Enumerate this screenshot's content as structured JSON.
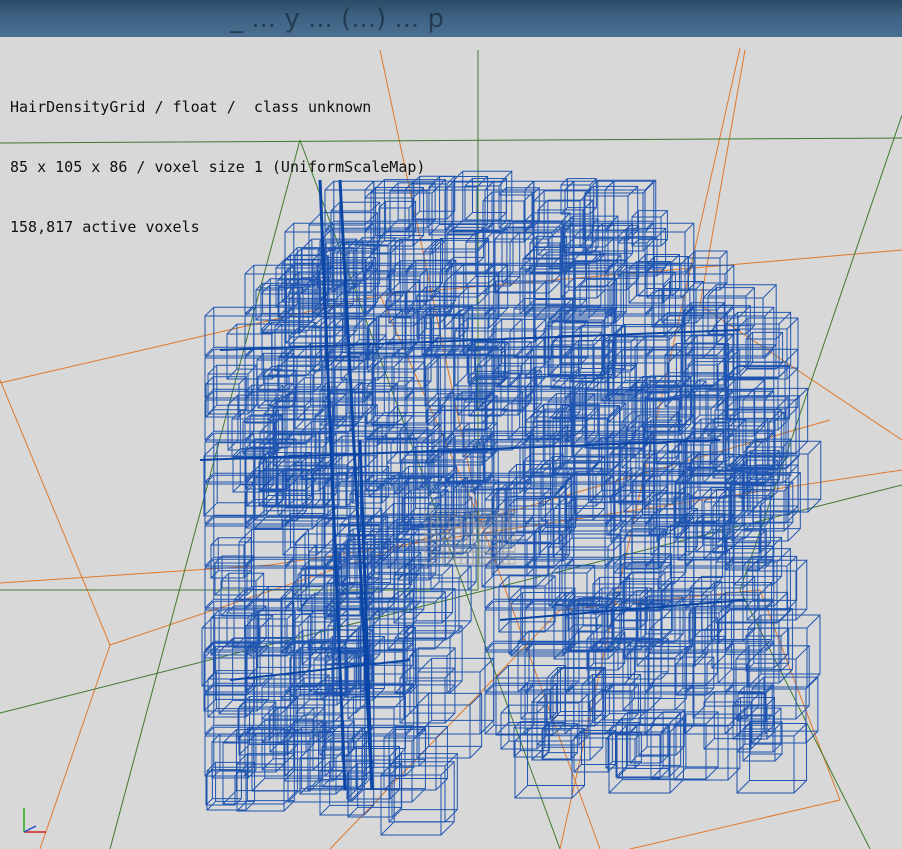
{
  "window": {
    "title": "_ ... y ... (...) ... p"
  },
  "overlay": {
    "grid_line": "HairDensityGrid / float /  class unknown",
    "dims_line": "85 x 105 x 86 / voxel size 1 (UniformScaleMap)",
    "voxels_line": "158,817 active voxels"
  },
  "colors": {
    "background": "#d8d8d8",
    "voxel_wire": "#1f55b0",
    "voxel_dense": "#0b45a5",
    "ground_orange": "#e0782a",
    "ground_green": "#3f7a2e",
    "gizmo_x": "#d02020",
    "gizmo_y": "#20b020",
    "gizmo_z": "#2050d0"
  },
  "icons": [
    "axis-gizmo-icon"
  ]
}
